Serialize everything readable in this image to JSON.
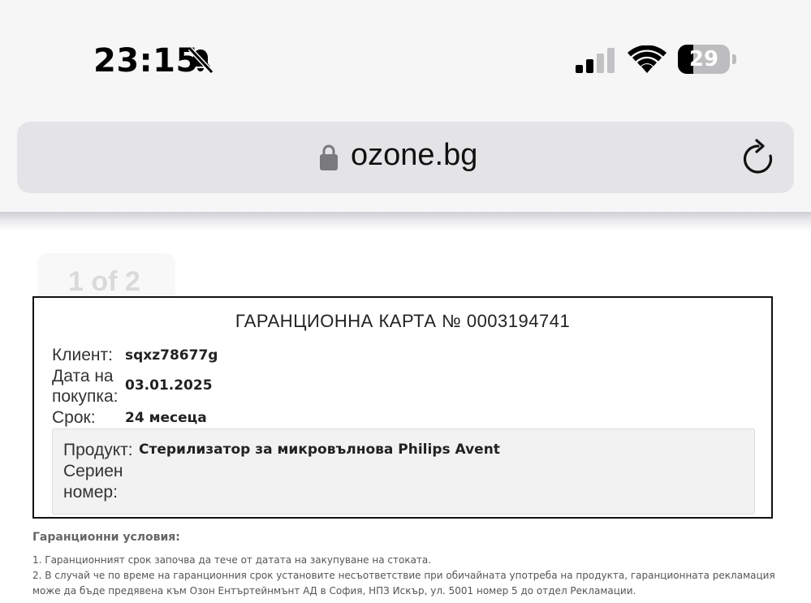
{
  "status_bar": {
    "time": "23:15",
    "battery_percent": "29",
    "battery_level": 0.29,
    "signal_bars_active": 2,
    "signal_bars_total": 4,
    "icons": [
      "bell-slash-icon",
      "cellular-signal-icon",
      "wifi-icon",
      "battery-icon"
    ]
  },
  "browser": {
    "url": "ozone.bg",
    "icons": [
      "lock-icon",
      "reload-icon"
    ]
  },
  "page_indicator": "1 of 2",
  "warranty_card": {
    "title": "ГАРАНЦИОННА КАРТА № 0003194741",
    "client_label": "Клиент:",
    "client_value": "sqxz78677g",
    "purchase_date_label_line1": "Дата на",
    "purchase_date_label_line2": "покупка:",
    "purchase_date_value": "03.01.2025",
    "term_label": "Срок:",
    "term_value": "24 месеца",
    "product_label": "Продукт:",
    "product_value": "Стерилизатор за микровълнова Philips Avent",
    "serial_label_line1": "Сериен",
    "serial_label_line2": "номер:",
    "serial_value": ""
  },
  "conditions": {
    "heading": "Гаранционни условия:",
    "items": [
      "1. Гаранционният срок започва да тече от датата на закупуване на стоката.",
      "2. В случай че по време на гаранционния срок установите несъответствие при обичайната употреба на продукта, гаранционната рекламация",
      "може да бъде предявена към Озон Ентъртейнмънт АД в София, НПЗ Искър, ул. 5001 номер 5 до отдел Рекламации."
    ]
  }
}
